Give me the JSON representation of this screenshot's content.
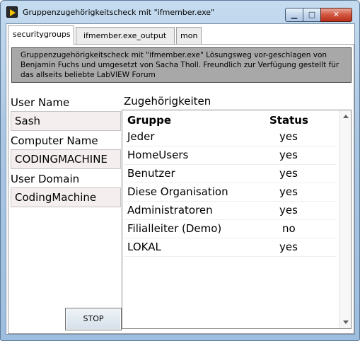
{
  "window": {
    "title": "Gruppenzugehörigkeitscheck mit \"ifmember.exe\"",
    "buttons": {
      "minimize": "▁",
      "maximize": "□",
      "close": "✕"
    }
  },
  "tabs": [
    {
      "label": "securitygroups",
      "active": true
    },
    {
      "label": "ifmember.exe_output",
      "active": false
    },
    {
      "label": "mon",
      "active": false
    }
  ],
  "info": {
    "text": "Gruppenzugehörigkeitscheck mit \"ifmember.exe\"  Lösungsweg vor-geschlagen von Benjamin Fuchs und umgesetzt von Sacha Tholl. Freundlich zur Verfügung gestellt für das allseits beliebte LabVIEW Forum"
  },
  "user": {
    "name_label": "User Name",
    "name_value": "Sash",
    "computer_label": "Computer Name",
    "computer_value": "CODINGMACHINE",
    "domain_label": "User Domain",
    "domain_value": "CodingMachine"
  },
  "groups": {
    "label": "Zugehörigkeiten",
    "header_group": "Gruppe",
    "header_status": "Status",
    "rows": [
      {
        "group": "Jeder",
        "status": "yes"
      },
      {
        "group": "HomeUsers",
        "status": "yes"
      },
      {
        "group": "Benutzer",
        "status": "yes"
      },
      {
        "group": "Diese Organisation",
        "status": "yes"
      },
      {
        "group": "Administratoren",
        "status": "yes"
      },
      {
        "group": "Filialleiter (Demo)",
        "status": "no"
      },
      {
        "group": "LOKAL",
        "status": "yes"
      }
    ]
  },
  "stop_button": "STOP",
  "colors": {
    "field_bg": "#f4eeee",
    "info_bg": "#a8a8a8",
    "close_red": "#d2553f"
  }
}
